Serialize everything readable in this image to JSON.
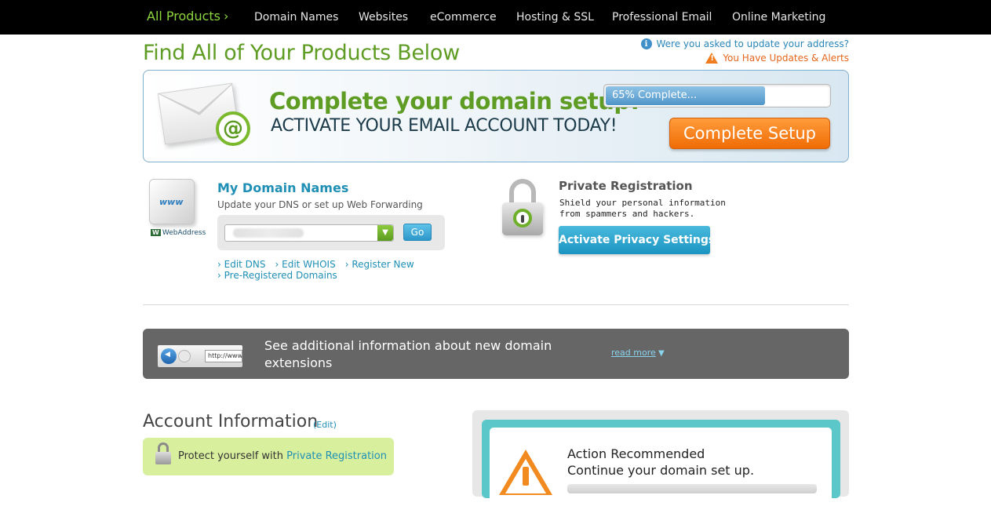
{
  "nav": {
    "items": [
      "All Products",
      "Domain Names",
      "Websites",
      "eCommerce",
      "Hosting & SSL",
      "Professional Email",
      "Online Marketing"
    ],
    "active_chevron": "›"
  },
  "page": {
    "title": "Find All of Your Products Below",
    "notice_info": "Were you asked to update your address?",
    "notice_alert": "You Have Updates & Alerts"
  },
  "banner": {
    "headline": "Complete your domain setup!",
    "subline": "ACTIVATE YOUR EMAIL ACCOUNT TODAY!",
    "progress_label": "65% Complete...",
    "progress_fraction": 0.705,
    "button": "Complete Setup",
    "envelope_glyph": "@"
  },
  "domains": {
    "title": "My Domain Names",
    "description": "Update your DNS or set up Web Forwarding",
    "go_button": "Go",
    "brand": "WebAddress",
    "brand_mark": "W",
    "cube_text": "www",
    "links": [
      "Edit DNS",
      "Edit WHOIS",
      "Register New",
      "Pre-Registered Domains"
    ]
  },
  "privacy": {
    "title": "Private Registration",
    "description": "Shield your personal information from spammers and hackers.",
    "button": "Activate Privacy Settings"
  },
  "info_bar": {
    "text": "See additional information about new domain extensions",
    "read_more": "read more",
    "url_preview": "http://www."
  },
  "account": {
    "title": "Account Information",
    "edit": "(Edit)",
    "protect_prefix": "Protect yourself with",
    "protect_link": "Private Registration"
  },
  "action": {
    "title": "Action Recommended",
    "subtitle": "Continue your domain set up."
  },
  "colors": {
    "nav_active": "#8cd63d",
    "title_green": "#5e9c23",
    "link_blue": "#1f8fb5",
    "accent_orange": "#f06c06",
    "teal": "#5bc7c9"
  },
  "icons": [
    "info-icon",
    "warning-icon",
    "envelope-icon",
    "www-cube-icon",
    "lock-icon",
    "chevron-down-icon",
    "browser-back-icon",
    "warning-large-icon"
  ]
}
